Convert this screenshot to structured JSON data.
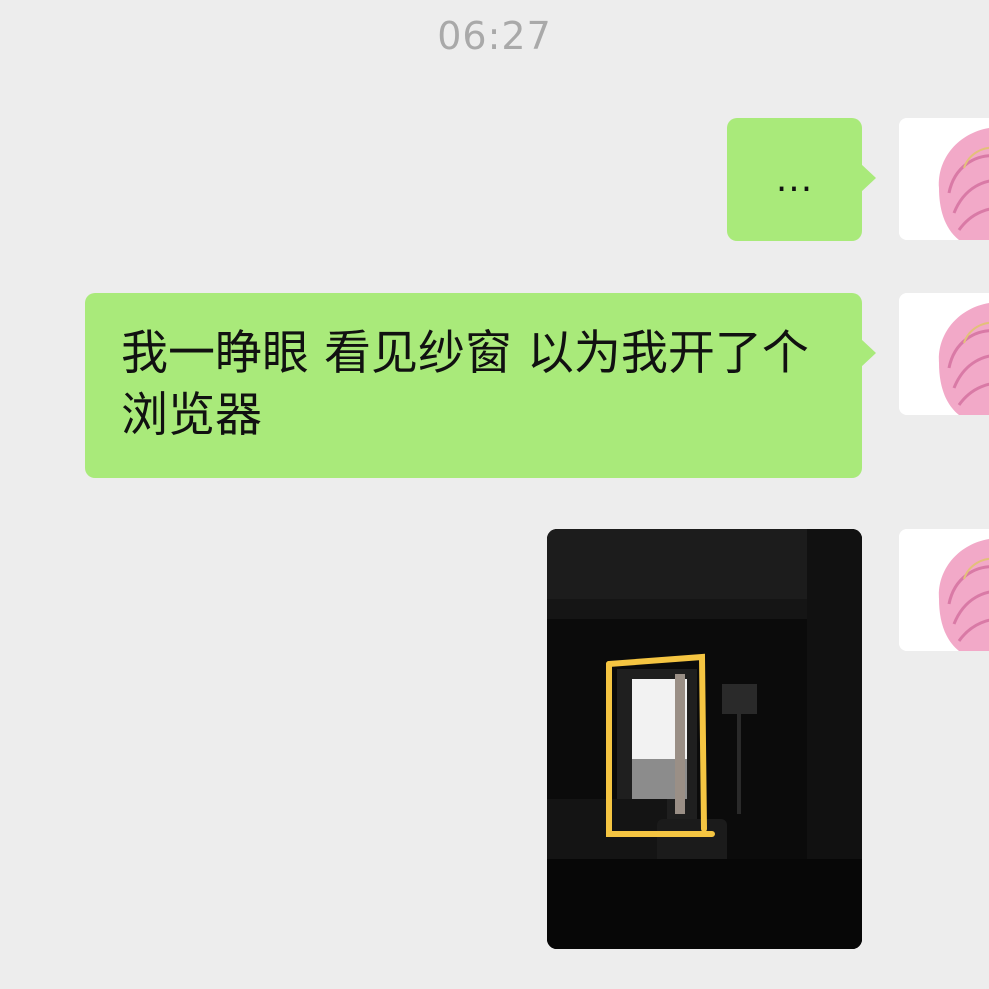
{
  "chat": {
    "timestamp": "06:27",
    "messages": [
      {
        "type": "text",
        "sender": "self",
        "text": "..."
      },
      {
        "type": "text",
        "sender": "self",
        "text": "我一睁眼 看见纱窗 以为我开了个浏览器"
      },
      {
        "type": "image",
        "sender": "self",
        "icon": "dark-room-window-photo"
      }
    ],
    "avatar_icon": "pink-flower-avatar"
  },
  "colors": {
    "background": "#ededed",
    "bubble": "#a9ea7a",
    "timestamp": "#a9a9a9",
    "highlight_stroke": "#f5c542"
  }
}
